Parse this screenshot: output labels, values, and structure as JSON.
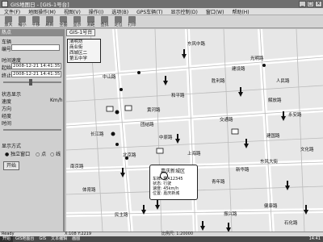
{
  "window": {
    "title": "GIS地图日 - [GIS-1号台]"
  },
  "menu": [
    "文件(F)",
    "地图操作(M)",
    "视图(V)",
    "操作(I)",
    "选项(B)",
    "GPS车辆(T)",
    "显示控制(D)",
    "窗口(W)",
    "帮助(H)"
  ],
  "toolbar": [
    "放大",
    "缩小",
    "平移",
    "刷新",
    "全图",
    "显示",
    "测距",
    "查找",
    "定位",
    "打印"
  ],
  "left_panel": {
    "title": "热点",
    "vehicle_label": "车辆",
    "id_label": "编号",
    "time_label": "时间速度",
    "from_label": "起始",
    "from_value": "2008-12-21 14:41:35",
    "to_label": "终止",
    "to_value": "2008-12-21 14:41:35",
    "speed_section": "状态显示",
    "speed_label": "速度",
    "speed_unit": "Km/h",
    "direction_label": "方向",
    "longitude_label": "经度",
    "time2_label": "时间",
    "display_section": "显示方式",
    "radio_options": [
      "独立窗口",
      "点",
      "线"
    ],
    "start_button": "开始"
  },
  "map": {
    "tab": "GIS-1号台",
    "labels": [
      "东风中路",
      "中山路",
      "建设路",
      "胜利路",
      "人民路",
      "黄河路",
      "长江路",
      "交通路",
      "建国路",
      "北京路",
      "南京路",
      "上海路",
      "东风大街",
      "永安路",
      "解放路",
      "和平路",
      "健康路",
      "体育路",
      "青年路",
      "文化路",
      "团结路",
      "新华路",
      "光明路",
      "振兴路",
      "民主路",
      "石化路",
      "中原路"
    ],
    "poi_box": [
      "清明坊",
      "商业街",
      "西城区二",
      "第五中学"
    ],
    "popup": {
      "title": "嘉庆新城区",
      "lines": [
        "车牌: 豫A12345",
        "状态: 行驶",
        "速度: 45km/h",
        "位置: 嘉庆新城"
      ]
    }
  },
  "status": {
    "left": "Ready",
    "coords": "X:108  Y:2219",
    "right": "比例尺: 1:20000"
  },
  "taskbar": [
    "开始",
    "GIS地图台",
    "GIS",
    "文本编辑",
    "画图"
  ],
  "clock": "14:41"
}
